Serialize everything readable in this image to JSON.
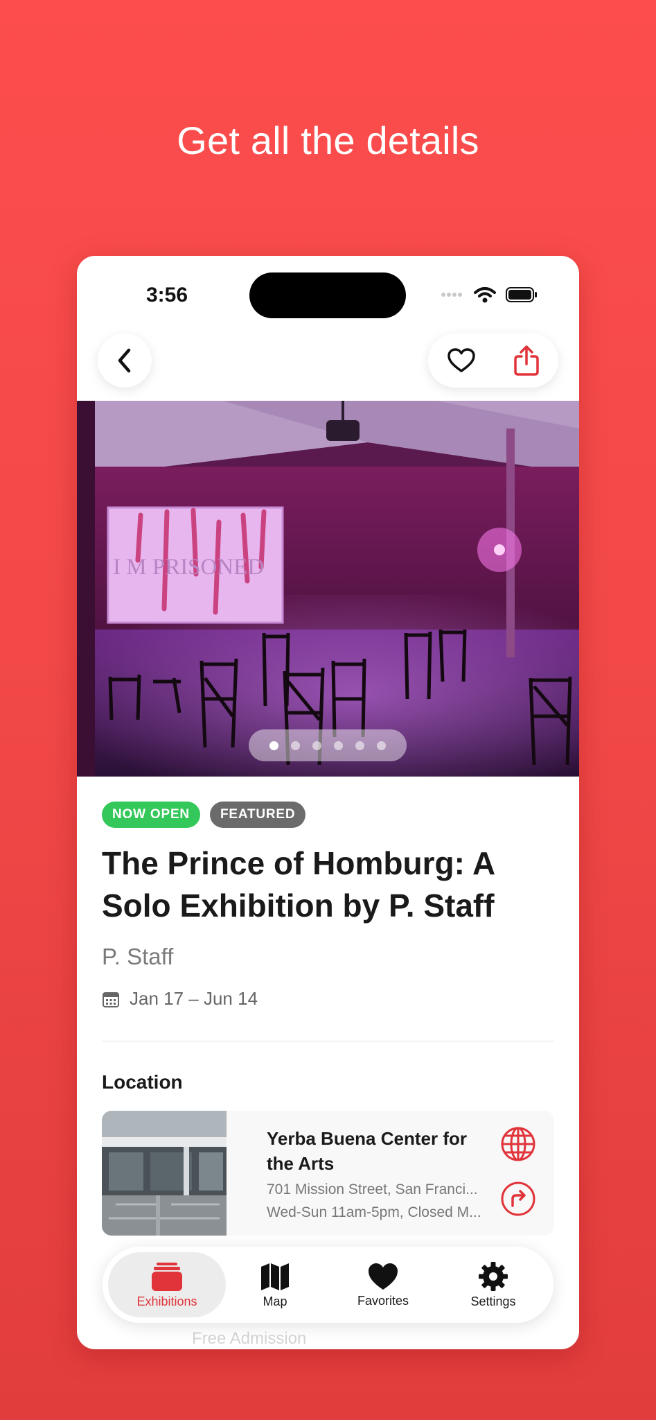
{
  "headline": "Get all the details",
  "status_bar": {
    "time": "3:56"
  },
  "badges": [
    {
      "label": "NOW OPEN",
      "color": "#34c759"
    },
    {
      "label": "FEATURED",
      "color": "#6b6b6b"
    }
  ],
  "hero": {
    "screen_text": "I M PRISONED",
    "image_count": 6,
    "active_index": 0
  },
  "exhibition": {
    "title": "The Prince of Homburg: A Solo Exhibition by P. Staff",
    "artist": "P. Staff",
    "dates": "Jan 17 – Jun 14"
  },
  "location": {
    "section_title": "Location",
    "venue_name": "Yerba Buena Center for the Arts",
    "address": "701 Mission Street, San Franci...",
    "hours": "Wed-Sun 11am-5pm, Closed M..."
  },
  "tabbar": {
    "items": [
      {
        "label": "Exhibitions",
        "icon": "exhibitions-stack-icon",
        "active": true
      },
      {
        "label": "Map",
        "icon": "map-icon",
        "active": false
      },
      {
        "label": "Favorites",
        "icon": "heart-icon",
        "active": false
      },
      {
        "label": "Settings",
        "icon": "gear-icon",
        "active": false
      }
    ]
  },
  "footer_peek": "Free Admission",
  "colors": {
    "accent": "#e0343a",
    "background": "#f24848"
  }
}
